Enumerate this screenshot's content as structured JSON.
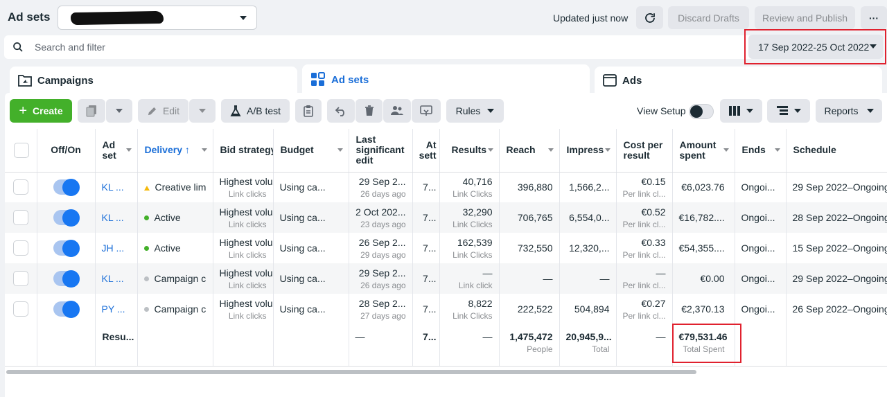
{
  "header": {
    "title": "Ad sets",
    "updated": "Updated just now",
    "discard": "Discard Drafts",
    "review": "Review and Publish",
    "more": "···"
  },
  "search": {
    "placeholder": "Search and filter"
  },
  "date_range": "17 Sep 2022-25 Oct 2022",
  "tabs": [
    {
      "label": "Campaigns"
    },
    {
      "label": "Ad sets"
    },
    {
      "label": "Ads"
    }
  ],
  "toolbar": {
    "create": "Create",
    "edit": "Edit",
    "ab_test": "A/B test",
    "rules": "Rules",
    "view_setup": "View Setup",
    "reports": "Reports"
  },
  "columns": {
    "offon": "Off/On",
    "adset": "Ad set",
    "delivery": "Delivery ↑",
    "bid": "Bid strategy",
    "budget": "Budget",
    "last_edit": "Last significant edit",
    "attr": "At sett",
    "results": "Results",
    "reach": "Reach",
    "impress": "Impress",
    "cost": "Cost per result",
    "amount": "Amount spent",
    "ends": "Ends",
    "schedule": "Schedule"
  },
  "rows": [
    {
      "name": "KL ...",
      "delivery": "Creative lim",
      "status": "warning",
      "bid": "Highest volu...",
      "bid_sub": "Link clicks",
      "budget": "Using ca...",
      "edit": "29 Sep 2...",
      "edit_sub": "26 days ago",
      "attr": "7...",
      "results": "40,716",
      "results_sub": "Link Clicks",
      "reach": "396,880",
      "impress": "1,566,2...",
      "cost": "€0.15",
      "cost_sub": "Per link cl...",
      "amount": "€6,023.76",
      "ends": "Ongoi...",
      "schedule": "29 Sep 2022–Ongoing"
    },
    {
      "name": "KL ...",
      "delivery": "Active",
      "status": "active",
      "bid": "Highest volu...",
      "bid_sub": "Link clicks",
      "budget": "Using ca...",
      "edit": "2 Oct 202...",
      "edit_sub": "23 days ago",
      "attr": "7...",
      "results": "32,290",
      "results_sub": "Link Clicks",
      "reach": "706,765",
      "impress": "6,554,0...",
      "cost": "€0.52",
      "cost_sub": "Per link cl...",
      "amount": "€16,782....",
      "ends": "Ongoi...",
      "schedule": "28 Sep 2022–Ongoing"
    },
    {
      "name": "JH ...",
      "delivery": "Active",
      "status": "active",
      "bid": "Highest volu...",
      "bid_sub": "Link clicks",
      "budget": "Using ca...",
      "edit": "26 Sep 2...",
      "edit_sub": "29 days ago",
      "attr": "7...",
      "results": "162,539",
      "results_sub": "Link Clicks",
      "reach": "732,550",
      "impress": "12,320,...",
      "cost": "€0.33",
      "cost_sub": "Per link cl...",
      "amount": "€54,355....",
      "ends": "Ongoi...",
      "schedule": "15 Sep 2022–Ongoing"
    },
    {
      "name": "KL ...",
      "delivery": "Campaign c",
      "status": "off",
      "bid": "Highest volu...",
      "bid_sub": "Link clicks",
      "budget": "Using ca...",
      "edit": "29 Sep 2...",
      "edit_sub": "26 days ago",
      "attr": "7...",
      "results": "—",
      "results_sub": "Link click",
      "reach": "—",
      "impress": "—",
      "cost": "—",
      "cost_sub": "Per link cl...",
      "amount": "€0.00",
      "ends": "Ongoi...",
      "schedule": "29 Sep 2022–Ongoing"
    },
    {
      "name": "PY ...",
      "delivery": "Campaign c",
      "status": "off",
      "bid": "Highest volu...",
      "bid_sub": "Link clicks",
      "budget": "Using ca...",
      "edit": "28 Sep 2...",
      "edit_sub": "27 days ago",
      "attr": "7...",
      "results": "8,822",
      "results_sub": "Link Clicks",
      "reach": "222,522",
      "impress": "504,894",
      "cost": "€0.27",
      "cost_sub": "Per link cl...",
      "amount": "€2,370.13",
      "ends": "Ongoi...",
      "schedule": "26 Sep 2022–Ongoing"
    }
  ],
  "totals": {
    "label": "Resu...",
    "edit": "—",
    "attr": "7...",
    "results": "—",
    "reach": "1,475,472",
    "reach_sub": "People",
    "impress": "20,945,9...",
    "impress_sub": "Total",
    "cost": "—",
    "amount": "€79,531.46",
    "amount_sub": "Total Spent"
  },
  "colors": {
    "accent": "#1877f2",
    "create": "#43b02a",
    "highlight": "#e0212e",
    "active": "#43b02a",
    "warning": "#f5b90a",
    "off": "#bcc0c4"
  }
}
